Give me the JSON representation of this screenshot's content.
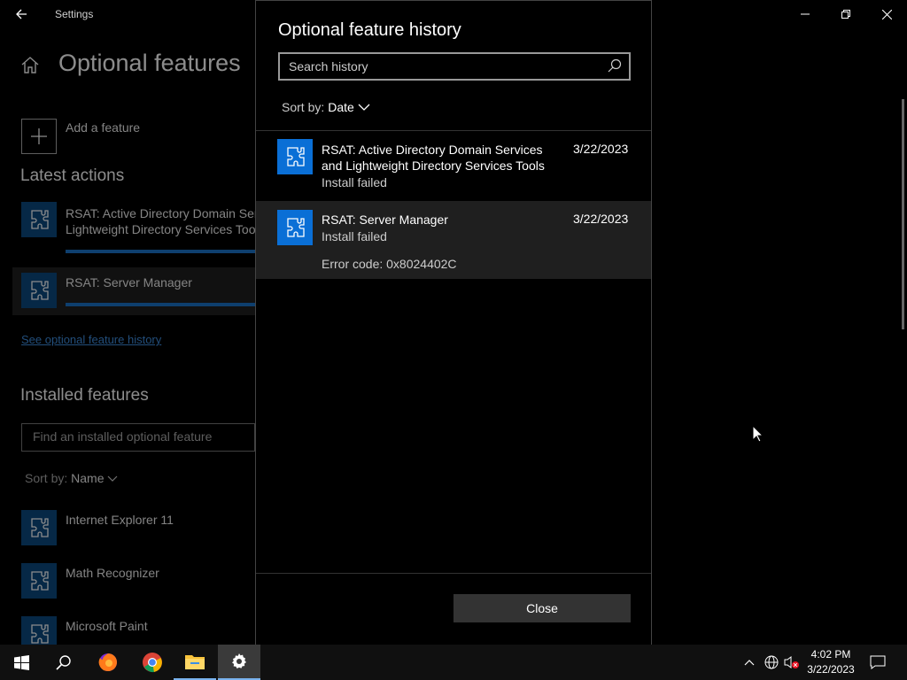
{
  "window": {
    "app_title": "Settings"
  },
  "background_page": {
    "title": "Optional features",
    "add_feature_label": "Add a feature",
    "latest_actions_heading": "Latest actions",
    "latest_actions": [
      {
        "line1": "RSAT: Active Directory Domain Serv",
        "line2": "Lightweight Directory Services Tool",
        "progress": 1.0
      },
      {
        "line1": "RSAT: Server Manager",
        "line2": "",
        "progress": 1.0
      }
    ],
    "history_link": "See optional feature history",
    "installed_heading": "Installed features",
    "find_placeholder": "Find an installed optional feature",
    "sort_label": "Sort by:",
    "sort_value": "Name",
    "installed": [
      "Internet Explorer 11",
      "Math Recognizer",
      "Microsoft Paint"
    ]
  },
  "dialog": {
    "title": "Optional feature history",
    "search_placeholder": "Search history",
    "sort_label": "Sort by:",
    "sort_value": "Date",
    "items": [
      {
        "name": "RSAT: Active Directory Domain Services and Lightweight Directory Services Tools",
        "status": "Install failed",
        "date": "3/22/2023",
        "error": ""
      },
      {
        "name": "RSAT: Server Manager",
        "status": "Install failed",
        "date": "3/22/2023",
        "error": "Error code: 0x8024402C"
      }
    ],
    "close_label": "Close"
  },
  "taskbar": {
    "time": "4:02 PM",
    "date": "3/22/2023",
    "apps": [
      "start-icon",
      "search-icon",
      "firefox-icon",
      "chrome-icon",
      "file-explorer-icon",
      "settings-icon"
    ]
  },
  "colors": {
    "accent": "#0a6fd6",
    "link": "#3f8ee0",
    "progress": "#1a73c9"
  }
}
